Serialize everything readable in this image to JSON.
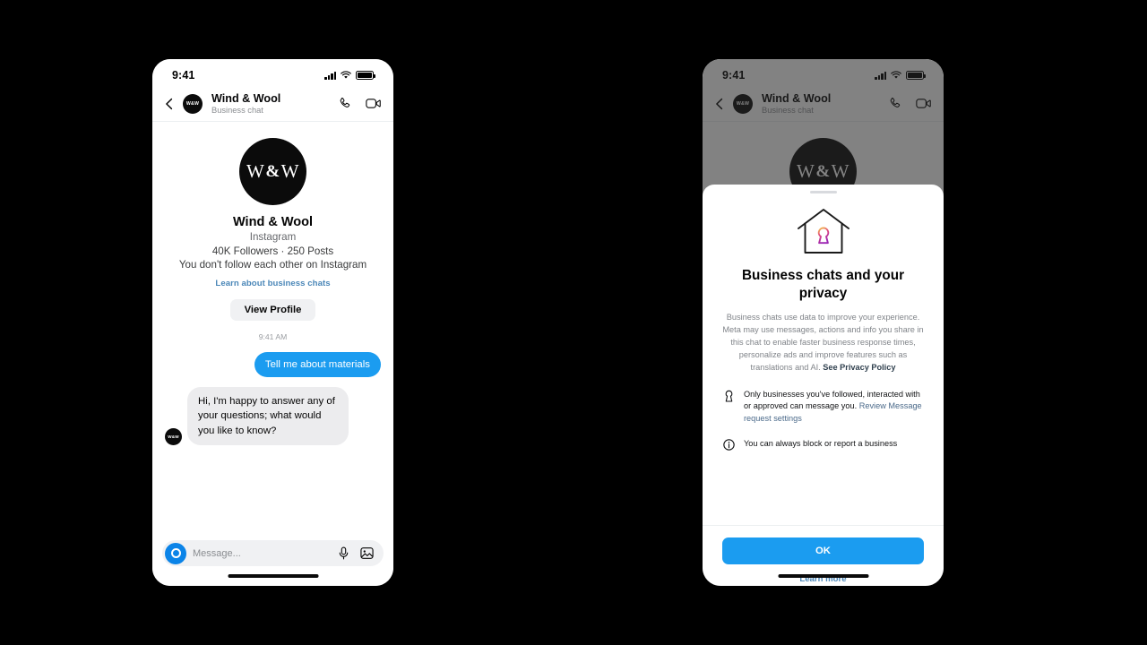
{
  "left_phone": {
    "status_bar": {
      "time": "9:41",
      "signal_icon": "signal-bars-icon",
      "wifi_icon": "wifi-icon",
      "battery_icon": "battery-icon"
    },
    "chat_header": {
      "back_icon": "back-chevron-icon",
      "avatar_initials": "W&W",
      "name": "Wind & Wool",
      "subtitle": "Business chat",
      "call_icon": "phone-call-icon",
      "video_icon": "video-camera-icon"
    },
    "profile": {
      "avatar_left": "W",
      "avatar_amp": "&",
      "avatar_right": "W",
      "name": "Wind & Wool",
      "platform": "Instagram",
      "stats": "40K Followers · 250 Posts",
      "relationship": "You don't follow each other on Instagram",
      "learn_link": "Learn about business chats",
      "view_profile_label": "View Profile",
      "timestamp": "9:41 AM"
    },
    "messages": [
      {
        "direction": "out",
        "text": "Tell me about materials"
      },
      {
        "direction": "in",
        "text": "Hi, I'm happy to answer any of your questions; what would you like to know?",
        "avatar_initials": "W&W"
      }
    ],
    "composer": {
      "camera_icon": "camera-circle-icon",
      "placeholder": "Message...",
      "mic_icon": "microphone-icon",
      "gallery_icon": "image-gallery-icon"
    }
  },
  "right_phone": {
    "status_bar": {
      "time": "9:41",
      "signal_icon": "signal-bars-icon",
      "wifi_icon": "wifi-icon",
      "battery_icon": "battery-icon"
    },
    "chat_header": {
      "back_icon": "back-chevron-icon",
      "avatar_initials": "W&W",
      "name": "Wind & Wool",
      "subtitle": "Business chat",
      "call_icon": "phone-call-icon",
      "video_icon": "video-camera-icon"
    },
    "profile": {
      "avatar_left": "W",
      "avatar_amp": "&",
      "avatar_right": "W"
    },
    "sheet": {
      "hero_icon": "house-keyhole-icon",
      "title": "Business chats and your privacy",
      "description": "Business chats use data to improve your experience. Meta may use messages, actions and info you share in this chat to enable faster business response times, personalize ads and improve features such as translations and AI. ",
      "description_link": "See Privacy Policy",
      "bullets": [
        {
          "icon": "keyhole-icon",
          "text": "Only businesses you've followed, interacted with or approved can message you. ",
          "link": "Review Message request settings"
        },
        {
          "icon": "info-circle-icon",
          "text": "You can always block or report a business",
          "link": ""
        }
      ],
      "ok_label": "OK",
      "learn_more_label": "Learn more"
    }
  },
  "colors": {
    "background": "#000000",
    "accent_blue": "#1b9cf0",
    "link_blue": "#4b87b8",
    "bubble_incoming": "#ececee",
    "muted_text": "#808489",
    "keyhole_gradient_start": "#f5c518",
    "keyhole_gradient_end": "#a020b0"
  }
}
